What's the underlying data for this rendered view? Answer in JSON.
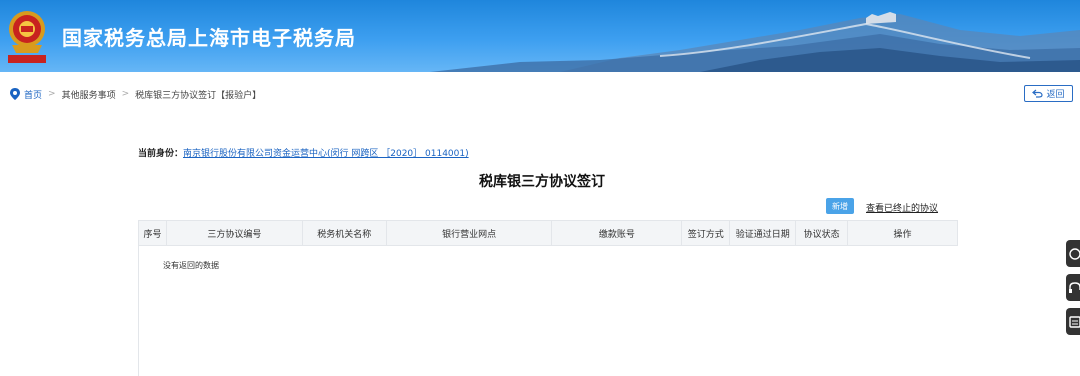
{
  "header": {
    "site_title": "国家税务总局上海市电子税务局",
    "emblem_name": "tax-emblem-icon"
  },
  "breadcrumb": {
    "home": "首页",
    "sep": ">",
    "level2": "其他服务事项",
    "current": "税库银三方协议签订【报验户】"
  },
  "back_button": {
    "label": "返回"
  },
  "identity": {
    "label": "当前身份：",
    "org": "南京银行股份有限公司资金运营中心(闵行 网跨区 ［2020］ 0114001)"
  },
  "page_title": "税库银三方协议签订",
  "actions": {
    "add_label": "新增",
    "view_terminated_label": "查看已终止的协议"
  },
  "table": {
    "columns": [
      "序号",
      "三方协议编号",
      "税务机关名称",
      "银行营业网点",
      "缴款账号",
      "签订方式",
      "验证通过日期",
      "协议状态",
      "操作"
    ],
    "empty_message": "没有返回的数据"
  },
  "side_tools": [
    "help-icon",
    "headset-icon",
    "notebook-icon"
  ],
  "colors": {
    "banner_blue": "#2a8ee6",
    "link_blue": "#1a63c2",
    "button_blue": "#4aa3e8"
  }
}
